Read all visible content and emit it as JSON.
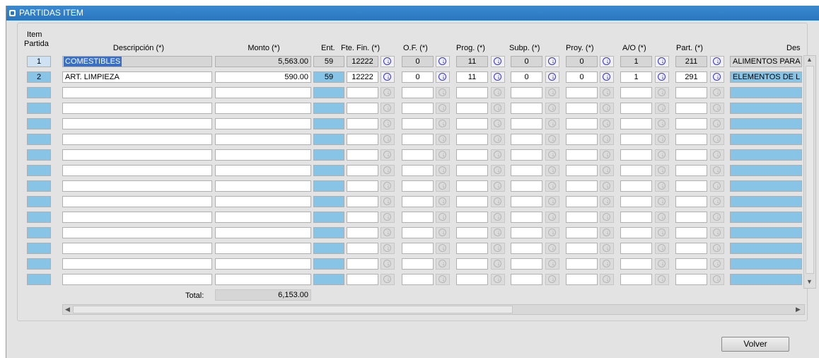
{
  "window": {
    "title": "PARTIDAS ITEM"
  },
  "headers": {
    "item_partida_line1": "Item",
    "item_partida_line2": "Partida",
    "descripcion": "Descripción (*)",
    "monto": "Monto (*)",
    "ent": "Ent.",
    "fte_fin": "Fte. Fin. (*)",
    "of": "O.F. (*)",
    "prog": "Prog. (*)",
    "subp": "Subp. (*)",
    "proy": "Proy. (*)",
    "ao": "A/O (*)",
    "part": "Part. (*)",
    "des": "Des"
  },
  "rows": [
    {
      "item": "1",
      "descripcion": "COMESTIBLES",
      "monto": "5,563.00",
      "ent": "59",
      "fte_fin": "12222",
      "of": "0",
      "prog": "11",
      "subp": "0",
      "proy": "0",
      "ao": "1",
      "part": "211",
      "des": "ALIMENTOS PARA"
    },
    {
      "item": "2",
      "descripcion": "ART. LIMPIEZA",
      "monto": "590.00",
      "ent": "59",
      "fte_fin": "12222",
      "of": "0",
      "prog": "11",
      "subp": "0",
      "proy": "0",
      "ao": "1",
      "part": "291",
      "des": "ELEMENTOS DE L"
    }
  ],
  "empty_row_count": 13,
  "lov_button_glyph": "(↓)",
  "total": {
    "label": "Total:",
    "value": "6,153.00"
  },
  "buttons": {
    "volver": "Volver"
  },
  "colors": {
    "title_bar": "#2a76c0",
    "row_blue": "#87c4e6",
    "selection": "#3a6fc4",
    "lov_arrow": "#1a1aa0"
  }
}
